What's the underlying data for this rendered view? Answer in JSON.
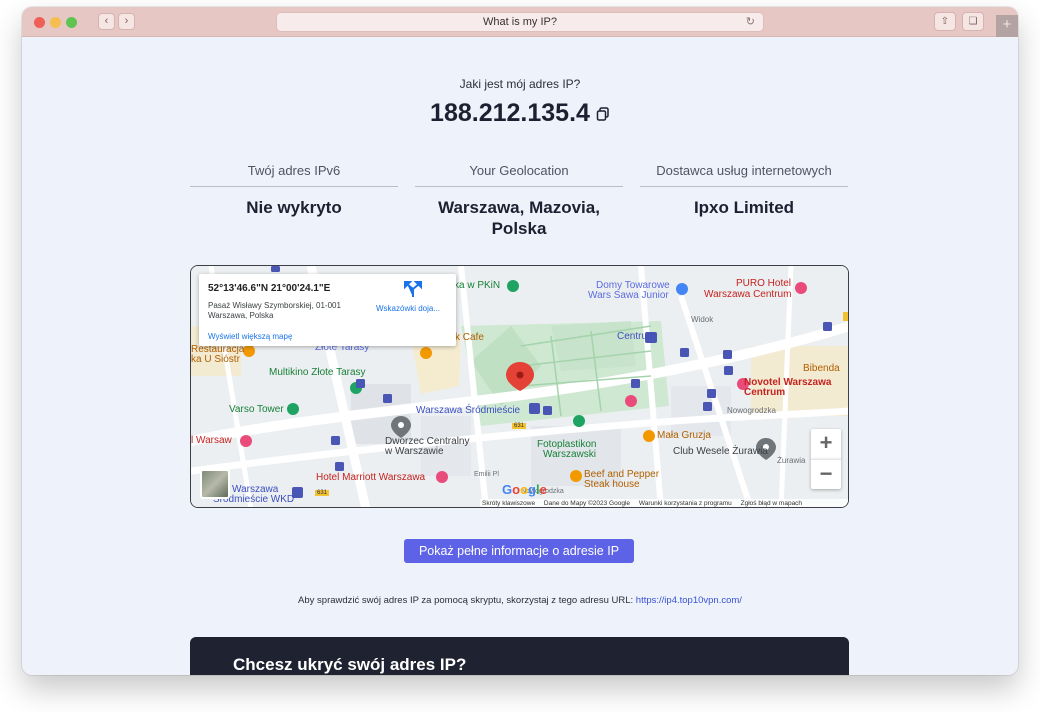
{
  "browser": {
    "address_text": "What is my IP?",
    "back_icon": "chevron-left-icon",
    "forward_icon": "chevron-right-icon",
    "reload_icon": "reload-icon",
    "share_icon": "share-icon",
    "tabs_icon": "tabs-icon",
    "new_tab_label": "+"
  },
  "header": {
    "question": "Jaki jest mój adres IP?",
    "ip_address": "188.212.135.4",
    "copy_icon": "copy-icon"
  },
  "info": [
    {
      "label": "Twój adres IPv6",
      "value": "Nie wykryto"
    },
    {
      "label": "Your Geolocation",
      "value": "Warszawa, Mazovia, Polska"
    },
    {
      "label": "Dostawca usług internetowych",
      "value": "Ipxo Limited"
    }
  ],
  "map": {
    "card": {
      "coords": "52°13'46.6\"N 21°00'24.1\"E",
      "address": "Pasaż Wisławy Szymborskiej, 01-001 Warszawa, Polska",
      "directions": "Wskazówki doja...",
      "bigger_map": "Wyświetl większą mapę"
    },
    "labels": {
      "pkin": "ka w PKiN",
      "domy": "Domy Towarowe",
      "wars": "Wars Sawa Junior",
      "puro": "PURO Hotel",
      "puro2": "Warszawa Centrum",
      "widok": "Widok",
      "cafe": "k Cafe",
      "centrum": "Centrum",
      "restauracja": "Restauracja",
      "siostr": "ka U Sióstr",
      "zlote": "Złote Tarasy",
      "multikino": "Multikino Złote Tarasy",
      "bibenda": "Bibenda",
      "novotel": "Novotel Warszawa",
      "novotel2": "Centrum",
      "varso": "Varso Tower",
      "srodmiescie": "Warszawa Śródmieście",
      "nowogrodzka": "Nowogrodzka",
      "warsaw": "l Warsaw",
      "dworzec": "Dworzec Centralny",
      "dworzec2": "w Warszawie",
      "fotoplastikon": "Fotoplastikon",
      "fotoplastikon2": "Warszawski",
      "mala": "Mała Gruzja",
      "club": "Club Wesele Żurawia",
      "zurawia": "Żurawia",
      "marriott": "Hotel Marriott Warszawa",
      "beef": "Beef and Pepper",
      "beef2": "Steak house",
      "wkd": "Warszawa",
      "wkd2": "Śródmieście WKD",
      "emilii": "Emilii Pl",
      "nowogrodzka2": "Nowogrodzka",
      "route631a": "631",
      "route631b": "631"
    },
    "zoom_in": "+",
    "zoom_out": "−",
    "google": [
      "G",
      "o",
      "o",
      "g",
      "l",
      "e"
    ],
    "attribution": [
      "Skróty klawiszowe",
      "Dane do Mapy ©2023 Google",
      "Warunki korzystania z programu",
      "Zgłoś błąd w mapach"
    ]
  },
  "cta": {
    "label": "Pokaż pełne informacje o adresie IP"
  },
  "script_note": {
    "text": "Aby sprawdzić swój adres IP za pomocą skryptu, skorzystaj z tego adresu URL: ",
    "link": "https://ip4.top10vpn.com/"
  },
  "promo": {
    "heading": "Chcesz ukryć swój adres IP?"
  }
}
